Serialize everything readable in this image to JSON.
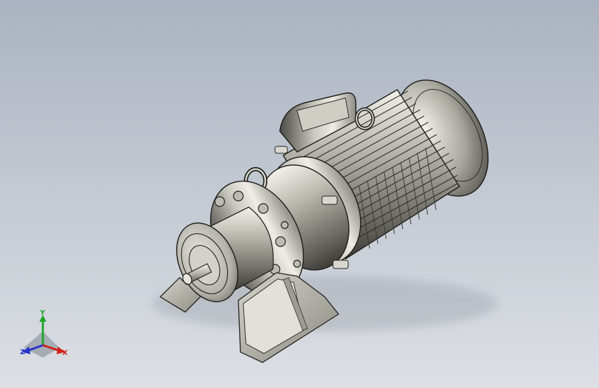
{
  "viewport": {
    "background_top": "#aab3c1",
    "background_bottom": "#dcdfe4",
    "model": "gear-reducer-motor"
  },
  "triad": {
    "x_label": "X",
    "y_label": "Y",
    "z_label": "Z",
    "x_color": "#d0201b",
    "y_color": "#1fa52a",
    "z_color": "#2634c9"
  }
}
